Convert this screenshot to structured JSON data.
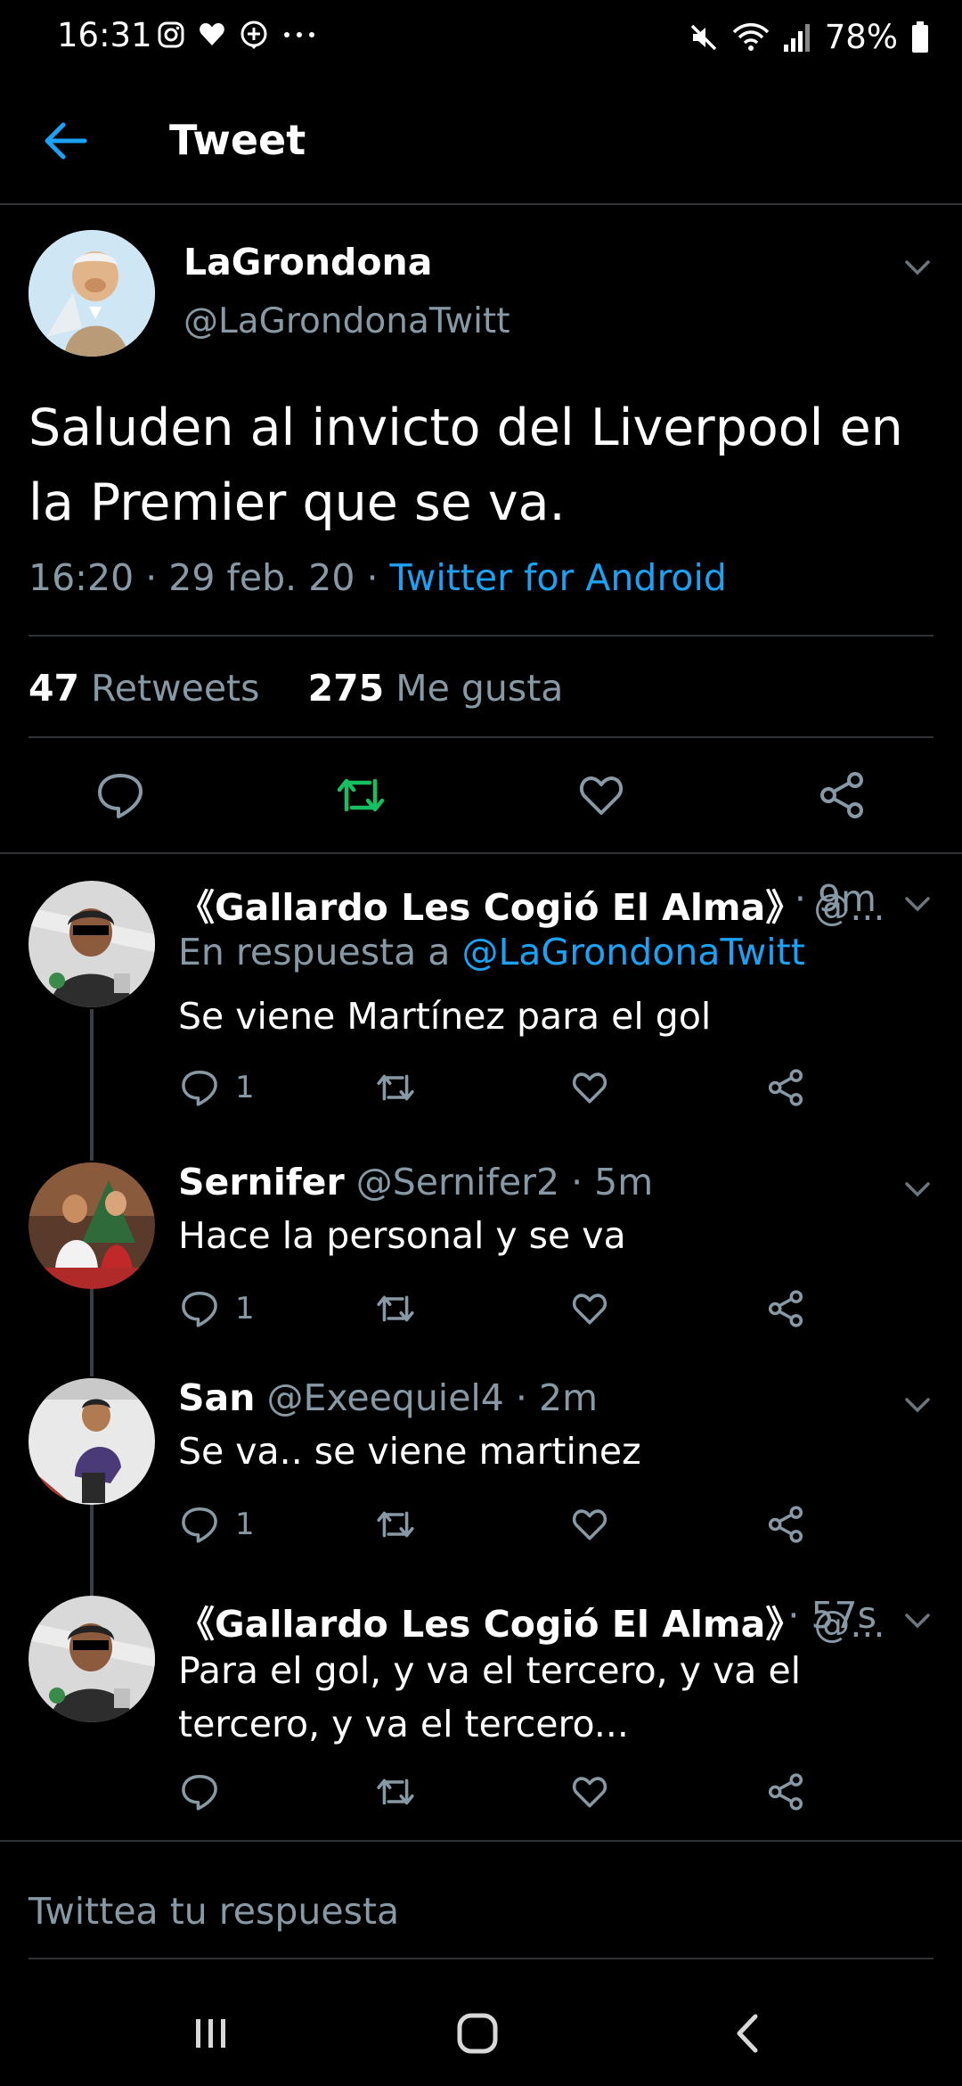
{
  "status_bar": {
    "time": "16:31",
    "battery": "78%"
  },
  "app_bar": {
    "title": "Tweet"
  },
  "main_tweet": {
    "name": "LaGrondona",
    "handle": "@LaGrondonaTwitt",
    "text": "Saluden al invicto del Liverpool en la Premier que se va.",
    "time": "16:20",
    "date": "29 feb. 20",
    "source": "Twitter for Android",
    "retweets_count": "47",
    "retweets_label": "Retweets",
    "likes_count": "275",
    "likes_label": "Me gusta"
  },
  "replies": [
    {
      "name": "《Gallardo Les Cogió El Alma》",
      "handle": "@...",
      "time": "· 9m",
      "reply_to_label": "En respuesta a",
      "reply_to_handle": "@LaGrondonaTwitt",
      "text": "Se viene Martínez para el gol",
      "reply_count": "1"
    },
    {
      "name": "Sernifer",
      "handle": "@Sernifer2 · 5m",
      "text": "Hace la personal y se va",
      "reply_count": "1"
    },
    {
      "name": "San",
      "handle": "@Exeequiel4 · 2m",
      "text": "Se va.. se viene martinez",
      "reply_count": "1"
    },
    {
      "name": "《Gallardo Les Cogió El Alma》",
      "handle": "@...",
      "time": "· 57s",
      "text": "Para el gol, y va el tercero, y va el tercero, y va el tercero...",
      "reply_count": ""
    }
  ],
  "compose": {
    "placeholder": "Twittea tu respuesta"
  },
  "colors": {
    "background": "#000000",
    "link": "#1da1f2",
    "secondary_text": "#8899a6",
    "retweet_active": "#17bf63",
    "divider": "#2f3336"
  }
}
